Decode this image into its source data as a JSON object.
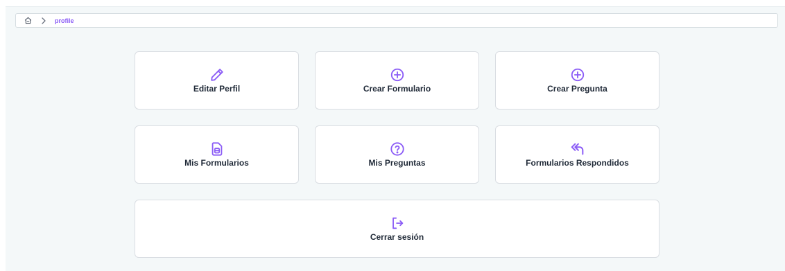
{
  "accent_color": "#8b5cf6",
  "breadcrumb": {
    "home_icon": "home-icon",
    "separator_icon": "chevron-right-icon",
    "current": "profile"
  },
  "cards": [
    {
      "label": "Editar Perfil",
      "icon": "pencil-icon"
    },
    {
      "label": "Crear Formulario",
      "icon": "plus-circle-icon"
    },
    {
      "label": "Crear Pregunta",
      "icon": "plus-circle-icon"
    },
    {
      "label": "Mis Formularios",
      "icon": "document-icon"
    },
    {
      "label": "Mis Preguntas",
      "icon": "question-circle-icon"
    },
    {
      "label": "Formularios Respondidos",
      "icon": "reply-all-icon"
    },
    {
      "label": "Cerrar sesión",
      "icon": "logout-icon"
    }
  ]
}
